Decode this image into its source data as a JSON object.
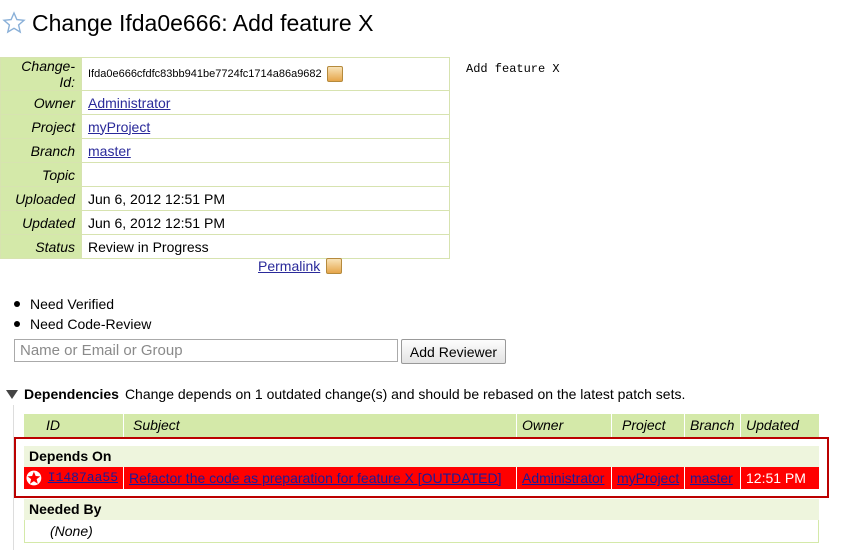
{
  "title": "Change Ifda0e666: Add feature X",
  "info": {
    "change_id_label": "Change-Id:",
    "change_id": "Ifda0e666cfdfc83bb941be7724fc1714a86a9682",
    "owner_label": "Owner",
    "owner": "Administrator",
    "project_label": "Project",
    "project": "myProject",
    "branch_label": "Branch",
    "branch": "master",
    "topic_label": "Topic",
    "topic": "",
    "uploaded_label": "Uploaded",
    "uploaded": "Jun 6, 2012 12:51 PM",
    "updated_label": "Updated",
    "updated": "Jun 6, 2012 12:51 PM",
    "status_label": "Status",
    "status": "Review in Progress"
  },
  "description": "Add feature X",
  "permalink": "Permalink",
  "needs": [
    "Need Verified",
    "Need Code-Review"
  ],
  "reviewer": {
    "placeholder": "Name or Email or Group",
    "button": "Add Reviewer"
  },
  "dependencies": {
    "title": "Dependencies",
    "message": "Change depends on 1 outdated change(s) and should be rebased on the latest patch sets.",
    "columns": [
      "ID",
      "Subject",
      "Owner",
      "Project",
      "Branch",
      "Updated"
    ],
    "depends_on_label": "Depends On",
    "depends_on": [
      {
        "id": "I1487aa55",
        "subject": "Refactor the code as preparation for feature X [OUTDATED]",
        "owner": "Administrator",
        "project": "myProject",
        "branch": "master",
        "updated": "12:51 PM"
      }
    ],
    "needed_by_label": "Needed By",
    "needed_by_none": "(None)"
  },
  "colors": {
    "header_green": "#d4e9a9",
    "outdated_red": "#ff0000",
    "highlight_border": "#bb0000"
  }
}
